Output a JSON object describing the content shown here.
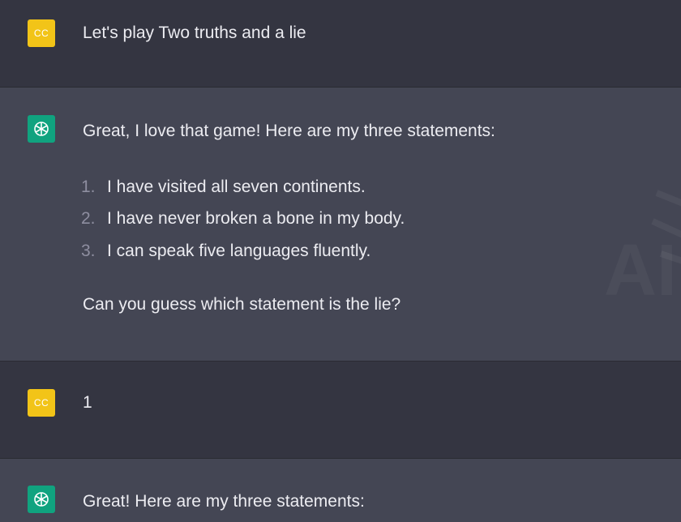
{
  "conversation": {
    "messages": [
      {
        "role": "user",
        "avatar_initials": "CC",
        "text": "Let's play  Two truths and a lie"
      },
      {
        "role": "assistant",
        "intro": "Great, I love that game! Here are my three statements:",
        "items": [
          {
            "num": "1.",
            "text": "I have visited all seven continents."
          },
          {
            "num": "2.",
            "text": "I have never broken a bone in my body."
          },
          {
            "num": "3.",
            "text": "I can speak five languages fluently."
          }
        ],
        "outro": "Can you guess which statement is the lie?"
      },
      {
        "role": "user",
        "avatar_initials": "CC",
        "text": "1"
      },
      {
        "role": "assistant",
        "intro": "Great! Here are my three statements:"
      }
    ]
  },
  "watermark": {
    "text": "AI"
  },
  "colors": {
    "user_bg": "#343541",
    "assistant_bg": "#444654",
    "user_avatar": "#f2c418",
    "assistant_avatar": "#10a37f"
  }
}
